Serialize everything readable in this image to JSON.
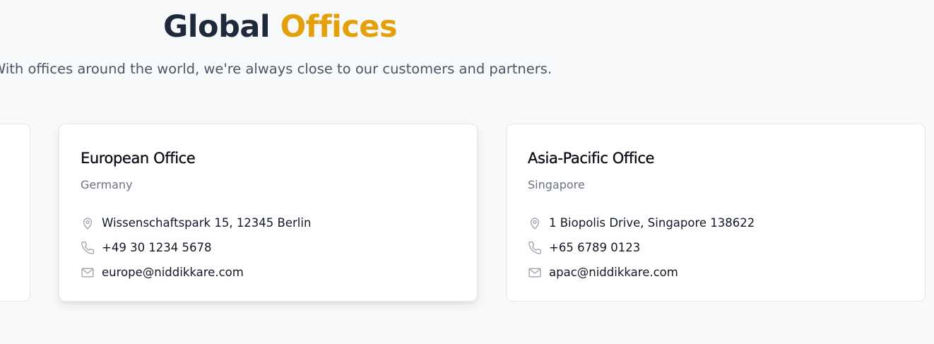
{
  "header": {
    "title_part1": "Global",
    "title_part2": "Offices",
    "subtitle": "With offices around the world, we're always close to our customers and partners."
  },
  "offices": [
    {
      "name": "European Office",
      "country": "Germany",
      "address": "Wissenschaftspark 15, 12345 Berlin",
      "phone": "+49 30 1234 5678",
      "email": "europe@niddikkare.com"
    },
    {
      "name": "Asia-Pacific Office",
      "country": "Singapore",
      "address": "1 Biopolis Drive, Singapore 138622",
      "phone": "+65 6789 0123",
      "email": "apac@niddikkare.com"
    }
  ],
  "icons": {
    "address": "map-pin-icon",
    "phone": "phone-icon",
    "email": "mail-icon"
  },
  "colors": {
    "title_dark": "#1e293b",
    "accent": "#e3a008",
    "subtitle": "#4b5563",
    "icon": "#9ca3af",
    "page_bg": "#f8f9fb"
  }
}
